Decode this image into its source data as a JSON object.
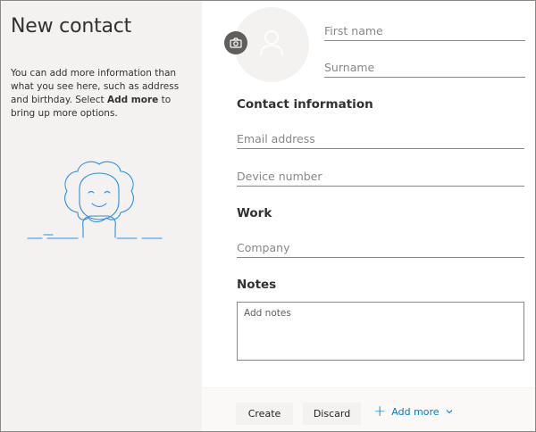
{
  "left": {
    "title": "New contact",
    "desc_part1": "You can add more information than what you see here, such as address and birthday. Select ",
    "desc_bold": "Add more",
    "desc_part2": " to bring up more options."
  },
  "icons": {
    "camera": "camera-icon",
    "person": "person-icon",
    "plus": "plus-icon",
    "chevron": "chevron-down-icon"
  },
  "fields": {
    "first_name_placeholder": "First name",
    "surname_placeholder": "Surname",
    "email_placeholder": "Email address",
    "device_placeholder": "Device number",
    "company_placeholder": "Company",
    "notes_placeholder": "Add notes"
  },
  "sections": {
    "contact_information": "Contact information",
    "work": "Work",
    "notes": "Notes"
  },
  "footer": {
    "create_label": "Create",
    "discard_label": "Discard",
    "add_more_label": "Add more"
  },
  "colors": {
    "accent": "#0078d4",
    "left_pane_bg": "#f3f2f1",
    "illustration_stroke": "#2e8ee8"
  }
}
